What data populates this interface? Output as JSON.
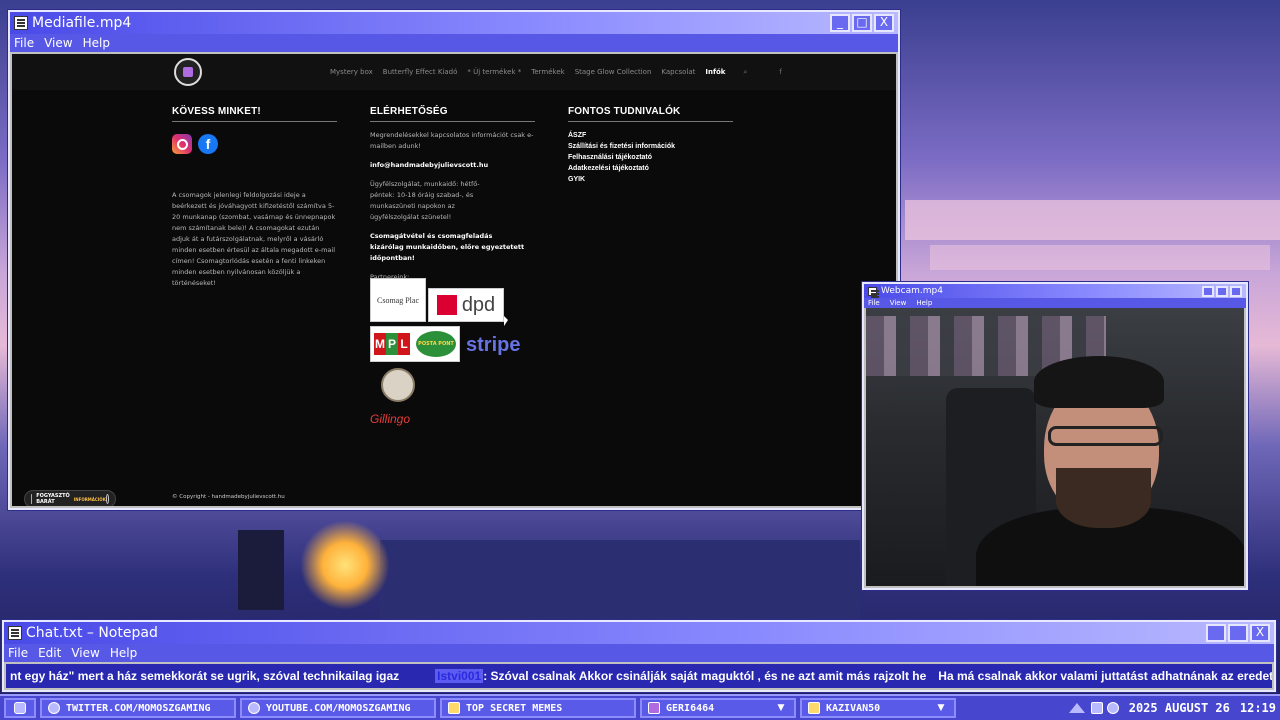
{
  "media_window": {
    "title": "Mediafile.mp4",
    "menu": [
      "File",
      "View",
      "Help"
    ],
    "controls": [
      "_",
      "□",
      "X"
    ]
  },
  "site": {
    "nav": [
      "Mystery box",
      "Butterfly Effect Kiadó",
      "* Új termékek *",
      "Termékek",
      "Stage Glow Collection",
      "Kapcsolat",
      "Infók"
    ],
    "nav_search_icon": "search-icon",
    "nav_facebook": "f",
    "follow": {
      "heading": "KÖVESS MINKET!",
      "text": "A csomagok jelenlegi feldolgozási ideje a beérkezett és jóváhagyott kifizetéstől számítva 5-20 munkanap (szombat, vasárnap és ünnepnapok nem számítanak bele)! A csomagokat ezután adjuk át a futárszolgálatnak, melyről a vásárló minden esetben értesül az általa megadott e-mail címen! Csomagtorlódás esetén a fenti linkeken minden esetben nyilvánosan közöljük a történéseket!"
    },
    "contact": {
      "heading": "ELÉRHETŐSÉG",
      "intro": "Megrendelésekkel kapcsolatos információt csak e-mailben adunk!",
      "email": "info@handmadebyjulievscott.hu",
      "hours": "Ügyfélszolgálat, munkaidő: hétfő-péntek: 10-18 óráig szabad-, és munkaszüneti napokon az ügyfélszolgálat szünetel!",
      "pickup": "Csomagátvétel és csomagfeladás kizárólag munkaidőben, előre egyeztetett időpontban!",
      "partners_label": "Partnereink:",
      "partners": {
        "p1": "Csomag Plac",
        "dpd": "dpd",
        "mpl": [
          "M",
          "P",
          "L"
        ],
        "postapont": "POSTA PONT",
        "stripe": "stripe",
        "gillingo": "Gillingo"
      }
    },
    "info": {
      "heading": "FONTOS TUDNIVALÓK",
      "links": [
        "ÁSZF",
        "Szállítási és fizetési információk",
        "Felhasználási tájékoztató",
        "Adatkezelési tájékoztató",
        "GYIK"
      ]
    },
    "badge_line1": "FOGYASZTÓ BARÁT",
    "badge_line2": "INFORMÁCIÓK",
    "copyright": "© Copyright - handmadebyjulievscott.hu"
  },
  "webcam_window": {
    "title": "Webcam.mp4",
    "menu": [
      "File",
      "View",
      "Help"
    ]
  },
  "notepad_window": {
    "title": "Chat.txt – Notepad",
    "menu": [
      "File",
      "Edit",
      "View",
      "Help"
    ],
    "chat_part1": "nt egy ház\" mert a ház semekkorát se ugrik, szóval technikailag igaz",
    "chat_username": "Istvi001",
    "chat_part2": ": Szóval csalnak  Akkor csinálják saját maguktól , és ne azt amit más rajzolt he",
    "chat_part3": "Ha má csalnak akkor valami juttatást adhatnának az eredeti készítőknek ha má tőlük szedik..."
  },
  "taskbar": {
    "items": [
      "TWITTER.COM/MOMOSZGAMING",
      "YOUTUBE.COM/MOMOSZGAMING",
      "TOP SECRET MEMES",
      "GERI6464",
      "KAZIVAN50"
    ],
    "date": "2025 AUGUST 26",
    "time": "12:19"
  }
}
